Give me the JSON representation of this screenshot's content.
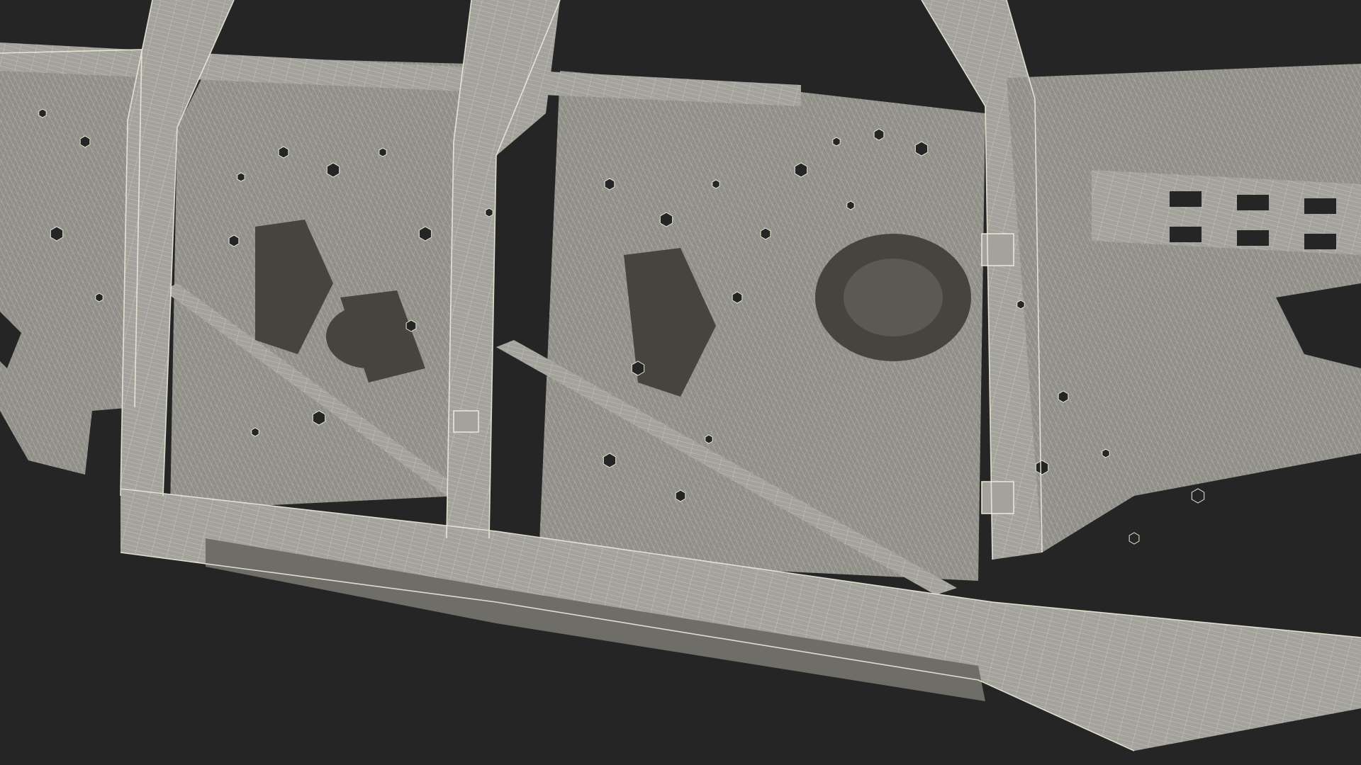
{
  "scene": {
    "subject": "car-body-frame-wireframe",
    "colors": {
      "background": "#252525",
      "panel": "#8f8e88",
      "panel_light": "#a3a29c",
      "panel_dark": "#6e6d68",
      "shadow": "#45443f",
      "wire": "#ecebd8"
    }
  }
}
